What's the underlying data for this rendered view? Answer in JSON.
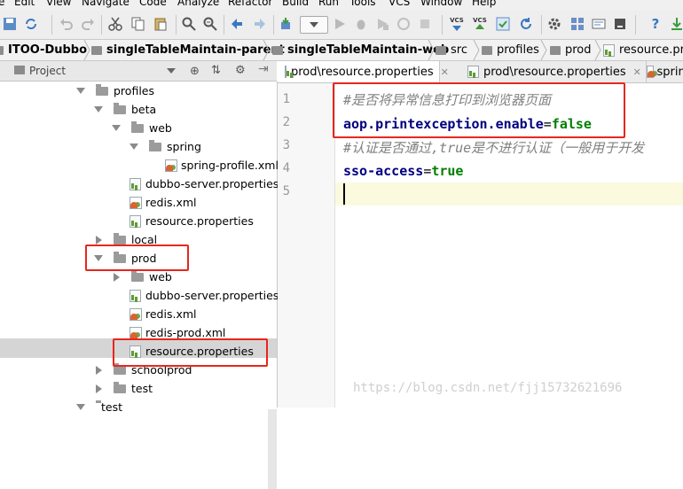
{
  "menu": [
    "e",
    "Edit",
    "View",
    "Navigate",
    "Code",
    "Analyze",
    "Refactor",
    "Build",
    "Run",
    "Tools",
    "VCS",
    "Window",
    "Help"
  ],
  "breadcrumbs": [
    "ITOO-Dubbo",
    "singleTableMaintain-parent",
    "singleTableMaintain-web",
    "src",
    "profiles",
    "prod",
    "resource.prop"
  ],
  "project_panel": {
    "title": "Project"
  },
  "tree": [
    {
      "label": "profiles",
      "type": "folder",
      "expand": "down"
    },
    {
      "label": "beta",
      "type": "folder",
      "expand": "down"
    },
    {
      "label": "web",
      "type": "folder",
      "expand": "down"
    },
    {
      "label": "spring",
      "type": "folder",
      "expand": "down"
    },
    {
      "label": "spring-profile.xml",
      "type": "xml"
    },
    {
      "label": "dubbo-server.properties",
      "type": "prop"
    },
    {
      "label": "redis.xml",
      "type": "xml"
    },
    {
      "label": "resource.properties",
      "type": "prop"
    },
    {
      "label": "local",
      "type": "folder",
      "expand": "right"
    },
    {
      "label": "prod",
      "type": "folder",
      "expand": "down"
    },
    {
      "label": "web",
      "type": "folder",
      "expand": "right"
    },
    {
      "label": "dubbo-server.properties",
      "type": "prop"
    },
    {
      "label": "redis.xml",
      "type": "xml"
    },
    {
      "label": "redis-prod.xml",
      "type": "xml"
    },
    {
      "label": "resource.properties",
      "type": "prop",
      "selected": true
    },
    {
      "label": "schoolprod",
      "type": "folder",
      "expand": "right"
    },
    {
      "label": "test",
      "type": "folder",
      "expand": "right"
    },
    {
      "label": "test",
      "type": "folder",
      "expand": "down"
    }
  ],
  "editor_tabs": [
    {
      "label": "prod\\resource.properties",
      "active": true
    },
    {
      "label": "prod\\resource.properties",
      "active": false
    },
    {
      "label": "spring",
      "active": false
    }
  ],
  "code": [
    {
      "line": "1",
      "comment": "#是否将异常信息打印到浏览器页面"
    },
    {
      "line": "2",
      "key": "aop.printexception.enable",
      "eq": "=",
      "value": "false"
    },
    {
      "line": "3",
      "comment": "#认证是否通过,true是不进行认证（一般用于开发"
    },
    {
      "line": "4",
      "key": "sso-access",
      "eq": "=",
      "value": "true"
    },
    {
      "line": "5"
    }
  ],
  "watermark": "https://blog.csdn.net/fjj15732621696",
  "colors": {
    "highlight_box": "#e8261d",
    "selection": "#d5d5d5",
    "comment": "#808080",
    "key": "#000080",
    "value": "#007f00"
  }
}
